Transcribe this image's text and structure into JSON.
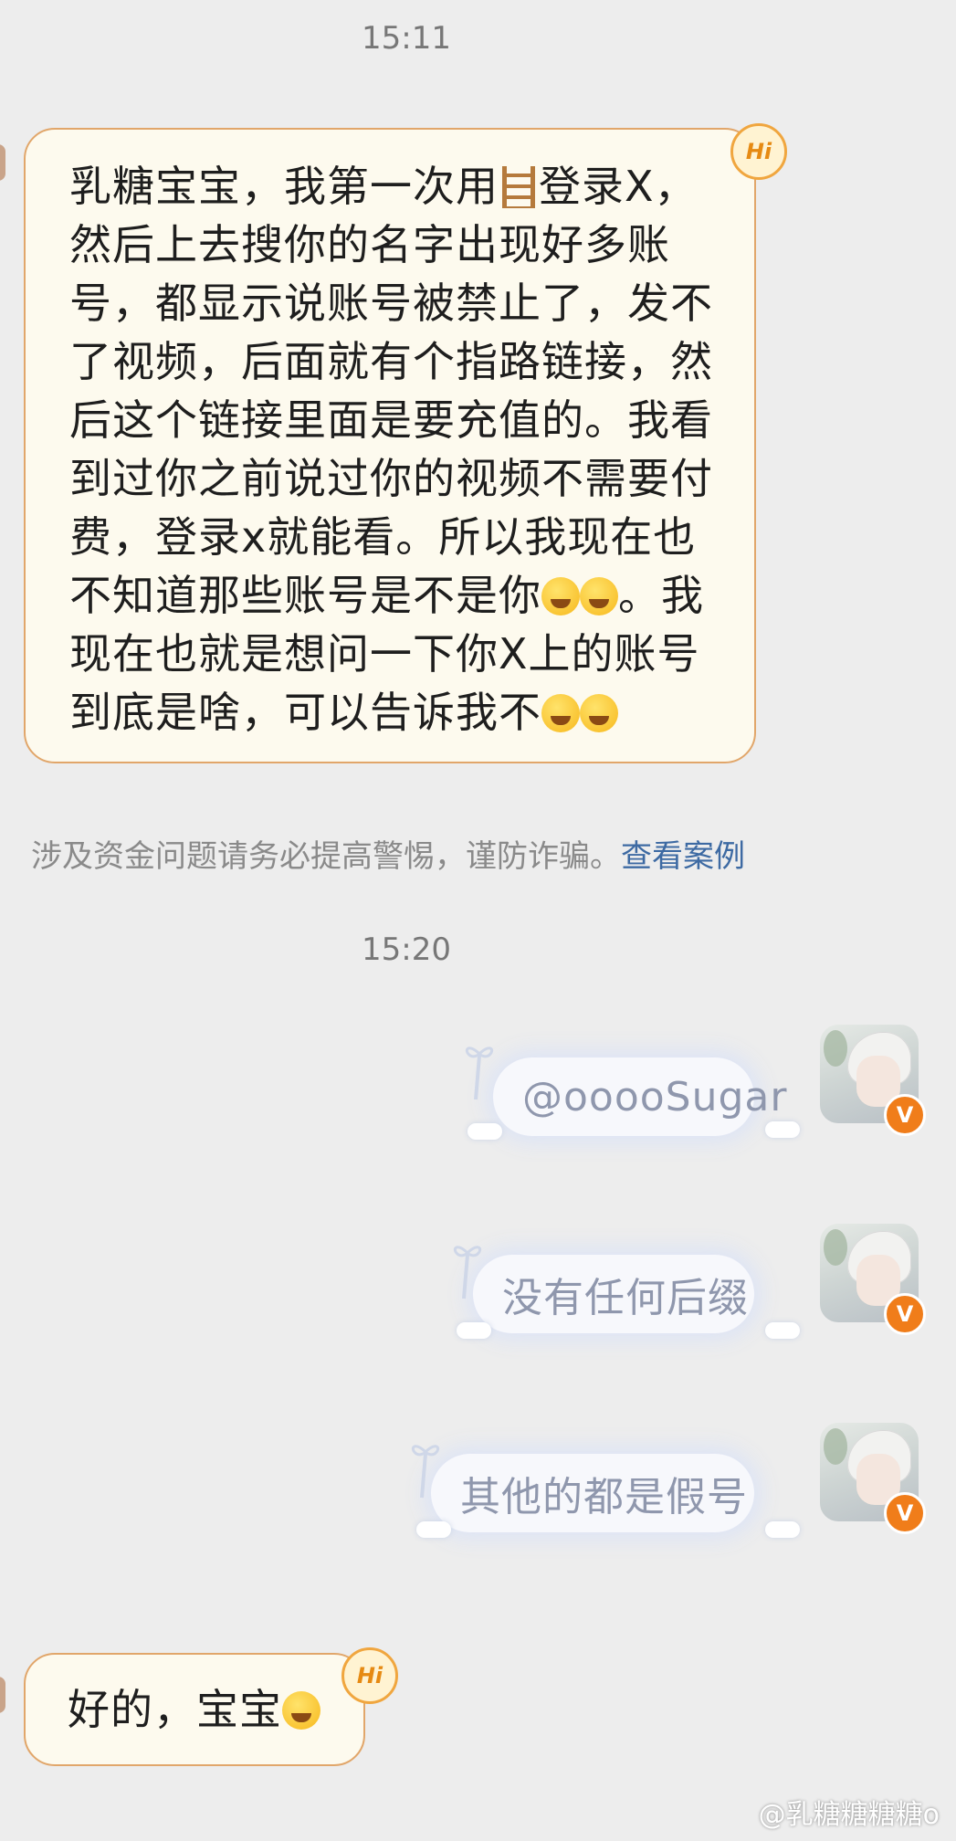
{
  "timestamps": {
    "first": "15:11",
    "second": "15:20"
  },
  "incoming_messages": [
    {
      "line1_before_icon": "乳糖宝宝，我第一次用",
      "ladder_icon": "ladder-icon",
      "line1_after_icon": "登录X，",
      "lines": [
        "然后上去搜你的名字出现好多账",
        "号，都显示说账号被禁止了，发不",
        "了视频，后面就有个指路链接，然",
        "后这个链接里面是要充值的。我看",
        "到过你之前说过你的视频不需要付",
        "费，登录x就能看。所以我现在也"
      ],
      "line8_before": "不知道那些账号是不是你",
      "line8_after": "。我",
      "line9": "现在也就是想问一下你X上的账号",
      "line10": "到底是啥，可以告诉我不",
      "badge": "Hi"
    },
    {
      "text": "好的，宝宝",
      "badge": "Hi"
    }
  ],
  "notice": {
    "text": "涉及资金问题请务必提高警惕，谨防诈骗。",
    "link": "查看案例"
  },
  "outgoing_messages": [
    {
      "text": "@ooooSugar"
    },
    {
      "text": "没有任何后缀"
    },
    {
      "text": "其他的都是假号"
    }
  ],
  "avatar_badge": "V",
  "watermark": "@乳糖糖糖糖o",
  "colors": {
    "background": "#ededed",
    "incoming_bubble": "#fdfaee",
    "incoming_border": "#e1a66a",
    "link": "#3d6aa3",
    "verified_badge": "#f07d1a"
  }
}
